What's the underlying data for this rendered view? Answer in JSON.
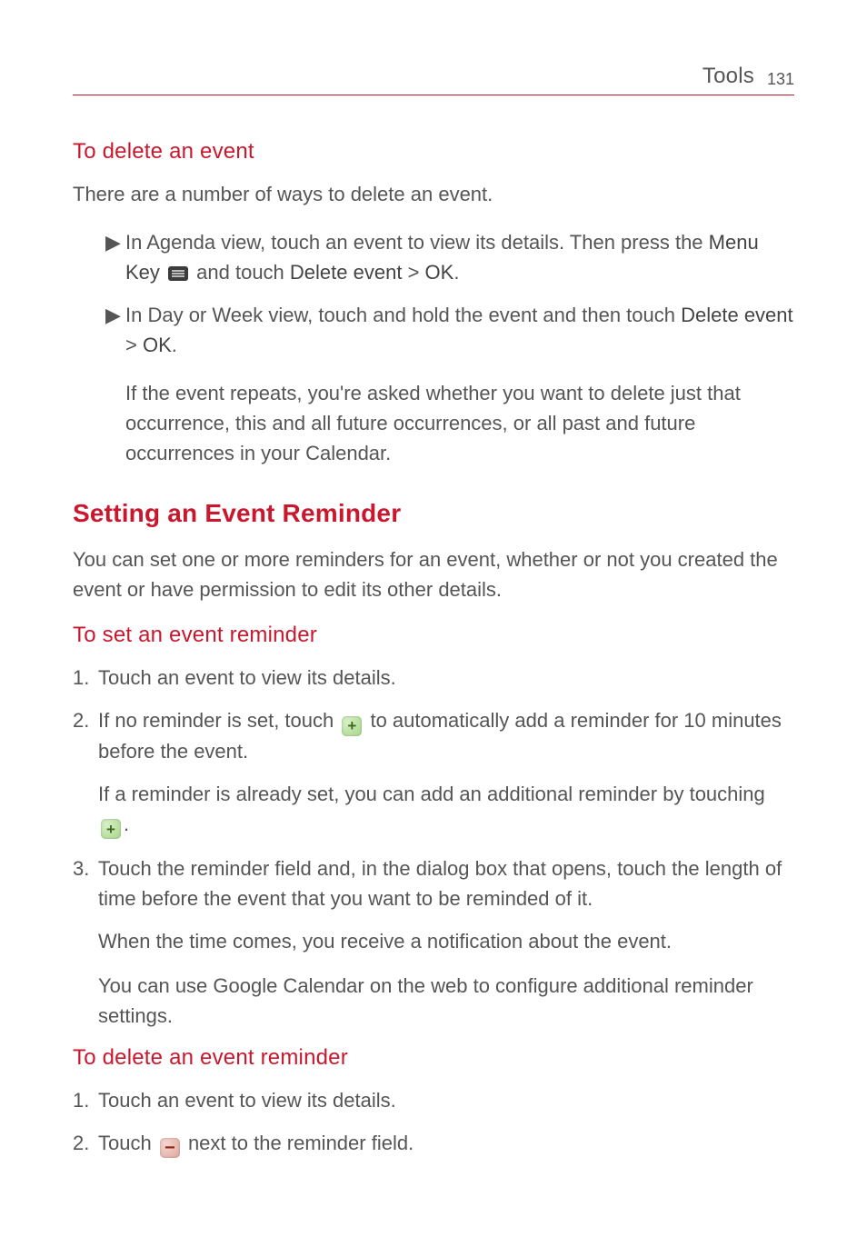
{
  "header": {
    "section": "Tools",
    "page_number": "131"
  },
  "delete_event": {
    "heading": "To delete an event",
    "intro": "There are a number of ways to delete an event.",
    "b1_a": "In Agenda view, touch an event to view its details. Then press the ",
    "b1_menu_key": "Menu Key",
    "b1_b": " and touch ",
    "b1_delete": "Delete event",
    "b1_c": " > ",
    "b1_ok": "OK",
    "b1_d": ".",
    "b2_a": "In Day or Week view, touch and hold the event and then touch ",
    "b2_delete": "Delete event",
    "b2_b": " > ",
    "b2_ok": "OK",
    "b2_c": ".",
    "repeats": "If the event repeats, you're asked whether you want to delete just that occurrence, this and all future occurrences, or all past and future occurrences in your Calendar."
  },
  "setting": {
    "heading": "Setting an Event Reminder",
    "intro": "You can set one or more reminders for an event, whether or not you created the event or have permission to edit its other details."
  },
  "set_reminder": {
    "heading": "To set an event reminder",
    "s1": "Touch an event to view its details.",
    "s2_a": "If no reminder is set, touch ",
    "s2_b": " to automatically add a reminder for 10 minutes before the event.",
    "s2_sub_a": "If a reminder is already set, you can add an additional reminder by touching ",
    "s2_sub_b": ".",
    "s3": "Touch the reminder field and, in the dialog box that opens, touch the length of time before the event that you want to be reminded of it.",
    "s3_sub1": "When the time comes, you receive a notification about the event.",
    "s3_sub2": "You can use Google Calendar on the web to configure additional reminder settings."
  },
  "delete_reminder": {
    "heading": "To delete an event reminder",
    "s1": "Touch an event to view its details.",
    "s2_a": "Touch ",
    "s2_b": " next to the reminder field."
  },
  "numbers": {
    "n1": "1.",
    "n2": "2.",
    "n3": "3."
  }
}
